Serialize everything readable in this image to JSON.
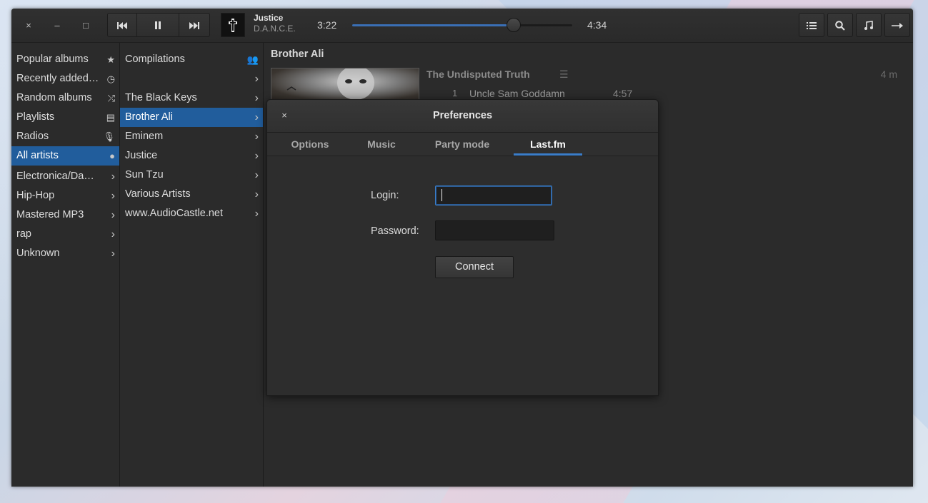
{
  "window_controls": {
    "close": "×",
    "minimize": "–",
    "maximize": "□"
  },
  "playback": {
    "prev_icon": "previous-track-icon",
    "pause_icon": "pause-icon",
    "next_icon": "next-track-icon"
  },
  "now_playing": {
    "title": "Justice",
    "album": "D.A.N.C.E.",
    "elapsed": "3:22",
    "total": "4:34",
    "progress": 0.73
  },
  "toolbar_right": [
    "list-icon",
    "search-icon",
    "music-note-icon",
    "arrow-right-icon"
  ],
  "genres": [
    {
      "label": "Popular albums",
      "icon": "star-icon",
      "glyph": "★"
    },
    {
      "label": "Recently added…",
      "icon": "clock-icon",
      "glyph": "◷"
    },
    {
      "label": "Random albums",
      "icon": "shuffle-icon",
      "glyph": "⤮"
    },
    {
      "label": "Playlists",
      "icon": "playlist-icon",
      "glyph": "▤"
    },
    {
      "label": "Radios",
      "icon": "microphone-icon",
      "glyph": "🎙"
    },
    {
      "label": "All artists",
      "icon": "person-icon",
      "glyph": "●",
      "selected": true
    },
    {
      "label": "Electronica/Da…",
      "icon": "chevron-right-icon",
      "glyph": "›"
    },
    {
      "label": "Hip-Hop",
      "icon": "chevron-right-icon",
      "glyph": "›"
    },
    {
      "label": "Mastered MP3",
      "icon": "chevron-right-icon",
      "glyph": "›"
    },
    {
      "label": "rap",
      "icon": "chevron-right-icon",
      "glyph": "›"
    },
    {
      "label": "Unknown",
      "icon": "chevron-right-icon",
      "glyph": "›"
    }
  ],
  "artists": [
    {
      "label": "Compilations",
      "icon": "group-icon",
      "glyph": "👥"
    },
    {
      "label": "",
      "icon": "chevron-right-icon",
      "glyph": "›"
    },
    {
      "label": "The Black Keys",
      "icon": "chevron-right-icon",
      "glyph": "›"
    },
    {
      "label": "Brother Ali",
      "icon": "chevron-right-icon",
      "glyph": "›",
      "selected": true
    },
    {
      "label": "Eminem",
      "icon": "chevron-right-icon",
      "glyph": "›"
    },
    {
      "label": "Justice",
      "icon": "chevron-right-icon",
      "glyph": "›"
    },
    {
      "label": "Sun Tzu",
      "icon": "chevron-right-icon",
      "glyph": "›"
    },
    {
      "label": "Various Artists",
      "icon": "chevron-right-icon",
      "glyph": "›"
    },
    {
      "label": "www.AudioCastle.net",
      "icon": "chevron-right-icon",
      "glyph": "›"
    }
  ],
  "album_view": {
    "artist": "Brother Ali",
    "album_title": "The Undisputed Truth",
    "album_duration": "4 m",
    "menu_glyph": "☰",
    "tracks": [
      {
        "no": "1",
        "name": "Uncle Sam Goddamn",
        "duration": "4:57"
      }
    ]
  },
  "dialog": {
    "close": "×",
    "title": "Preferences",
    "tabs": [
      "Options",
      "Music",
      "Party mode",
      "Last.fm"
    ],
    "active_tab": "Last.fm",
    "login_label": "Login:",
    "login_value": "",
    "password_label": "Password:",
    "password_value": "",
    "connect_label": "Connect"
  },
  "colors": {
    "accent": "#215d9c",
    "tab_underline": "#3a7dc9",
    "window_bg": "#2b2b2b"
  }
}
